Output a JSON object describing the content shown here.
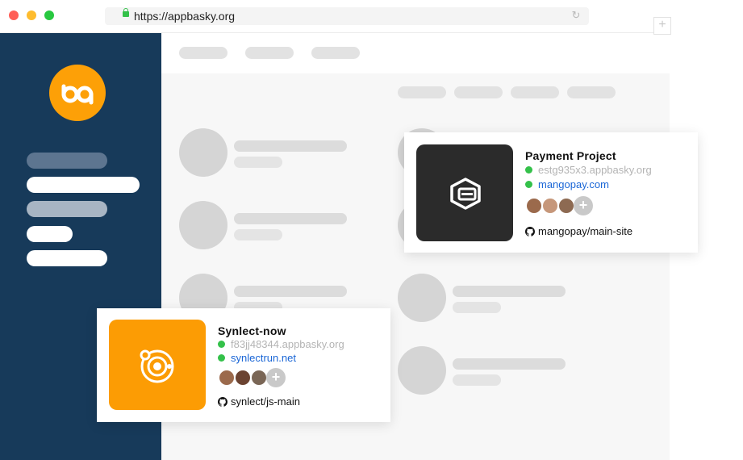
{
  "browser": {
    "url": "https://appbasky.org",
    "reload_icon": "reload-icon",
    "new_tab_icon": "plus-icon",
    "new_tab_glyph": "+",
    "reload_glyph": "↻",
    "traffic_light_colors": [
      "#ff5f57",
      "#febc2e",
      "#28c840"
    ]
  },
  "sidebar": {
    "background": "#173a5a",
    "logo_color": "#fda007",
    "logo_icon": "appbasky-logo"
  },
  "cards": [
    {
      "name": "Payment Project",
      "subdomain": "estg935x3.appbasky.org",
      "domain": "mangopay.com",
      "repo": "mangopay/main-site",
      "tile_color": "#2b2b2b",
      "tile_icon": "shield-icon",
      "add_glyph": "+"
    },
    {
      "name": "Synlect-now",
      "subdomain": "f83jj48344.appbasky.org",
      "domain": "synlectrun.net",
      "repo": "synlect/js-main",
      "tile_color": "#fc9c04",
      "tile_icon": "orbit-icon",
      "add_glyph": "+"
    }
  ],
  "colors": {
    "status_green": "#34c14a",
    "link_blue": "#1a66d6"
  }
}
